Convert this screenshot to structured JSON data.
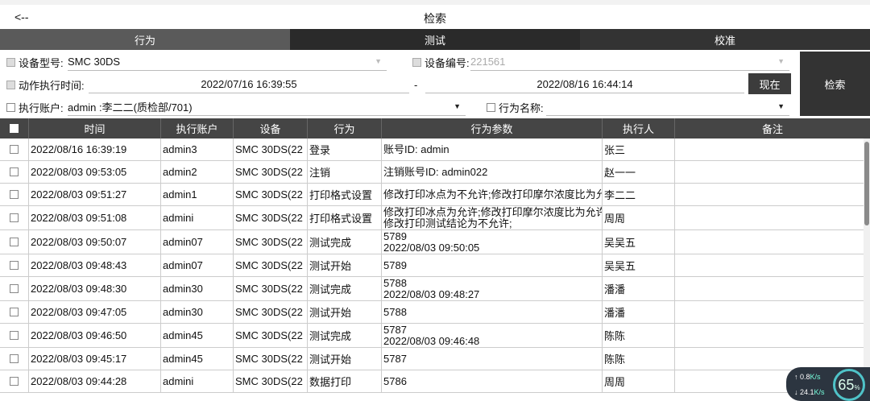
{
  "header": {
    "back_label": "<--",
    "title": "检索"
  },
  "tabs": [
    {
      "label": "行为"
    },
    {
      "label": "测试"
    },
    {
      "label": "校准"
    }
  ],
  "filters": {
    "device_model_label": "设备型号:",
    "device_model_value": "SMC 30DS",
    "device_number_label": "设备编号:",
    "device_number_value": "221561",
    "time_label": "动作执行时间:",
    "time_start": "2022/07/16 16:39:55",
    "time_separator": "-",
    "time_end": "2022/08/16 16:44:14",
    "now_button": "现在",
    "search_button": "检索",
    "account_label": "执行账户:",
    "account_value": "admin :李二二(质检部/701)",
    "action_name_label": "行为名称:",
    "action_name_value": ""
  },
  "table": {
    "headers": [
      "时间",
      "执行账户",
      "设备",
      "行为",
      "行为参数",
      "执行人",
      "备注"
    ],
    "rows": [
      {
        "time": "2022/08/16 16:39:19",
        "account": "admin3",
        "device": "SMC 30DS(22",
        "action": "登录",
        "params": [
          "账号ID: admin"
        ],
        "person": "张三",
        "note": ""
      },
      {
        "time": "2022/08/03 09:53:05",
        "account": "admin2",
        "device": "SMC 30DS(22",
        "action": "注销",
        "params": [
          "注销账号ID: admin022"
        ],
        "person": "赵一一",
        "note": ""
      },
      {
        "time": "2022/08/03 09:51:27",
        "account": "admin1",
        "device": "SMC 30DS(22",
        "action": "打印格式设置",
        "params": [
          "修改打印冰点为不允许;修改打印摩尔浓度比为允"
        ],
        "person": "李二二",
        "note": ""
      },
      {
        "time": "2022/08/03 09:51:08",
        "account": "admini",
        "device": "SMC 30DS(22",
        "action": "打印格式设置",
        "params": [
          "修改打印冰点为允许;修改打印摩尔浓度比为允许",
          "修改打印测试结论为不允许;"
        ],
        "person": "周周",
        "note": ""
      },
      {
        "time": "2022/08/03 09:50:07",
        "account": "admin07",
        "device": "SMC 30DS(22",
        "action": "测试完成",
        "params": [
          "5789",
          "2022/08/03 09:50:05"
        ],
        "person": "吴吴五",
        "note": ""
      },
      {
        "time": "2022/08/03 09:48:43",
        "account": "admin07",
        "device": "SMC 30DS(22",
        "action": "测试开始",
        "params": [
          "5789"
        ],
        "person": "吴吴五",
        "note": ""
      },
      {
        "time": "2022/08/03 09:48:30",
        "account": "admin30",
        "device": "SMC 30DS(22",
        "action": "测试完成",
        "params": [
          "5788",
          "2022/08/03 09:48:27"
        ],
        "person": "潘潘",
        "note": ""
      },
      {
        "time": "2022/08/03 09:47:05",
        "account": "admin30",
        "device": "SMC 30DS(22",
        "action": "测试开始",
        "params": [
          "5788"
        ],
        "person": "潘潘",
        "note": ""
      },
      {
        "time": "2022/08/03 09:46:50",
        "account": "admin45",
        "device": "SMC 30DS(22",
        "action": "测试完成",
        "params": [
          "5787",
          "2022/08/03 09:46:48"
        ],
        "person": "陈陈",
        "note": ""
      },
      {
        "time": "2022/08/03 09:45:17",
        "account": "admin45",
        "device": "SMC 30DS(22",
        "action": "测试开始",
        "params": [
          "5787"
        ],
        "person": "陈陈",
        "note": ""
      },
      {
        "time": "2022/08/03 09:44:28",
        "account": "admini",
        "device": "SMC 30DS(22",
        "action": "数据打印",
        "params": [
          "5786"
        ],
        "person": "周周",
        "note": ""
      }
    ]
  },
  "net_widget": {
    "up_value": "0.8",
    "up_unit": "K/s",
    "down_value": "24.1",
    "down_unit": "K/s",
    "gauge_value": "65",
    "gauge_unit": "%"
  }
}
